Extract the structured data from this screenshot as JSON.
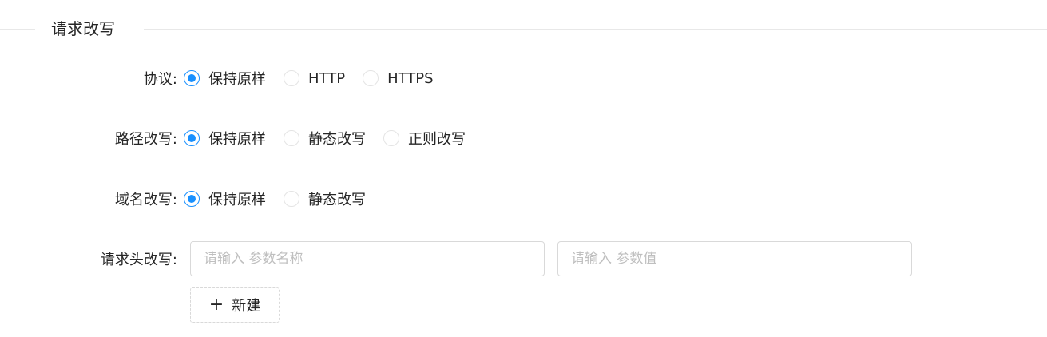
{
  "section": {
    "title": "请求改写"
  },
  "protocol": {
    "label": "协议:",
    "options": [
      {
        "label": "保持原样",
        "checked": true
      },
      {
        "label": "HTTP",
        "checked": false
      },
      {
        "label": "HTTPS",
        "checked": false
      }
    ]
  },
  "path_rewrite": {
    "label": "路径改写:",
    "options": [
      {
        "label": "保持原样",
        "checked": true
      },
      {
        "label": "静态改写",
        "checked": false
      },
      {
        "label": "正则改写",
        "checked": false
      }
    ]
  },
  "domain_rewrite": {
    "label": "域名改写:",
    "options": [
      {
        "label": "保持原样",
        "checked": true
      },
      {
        "label": "静态改写",
        "checked": false
      }
    ]
  },
  "header_rewrite": {
    "label": "请求头改写:",
    "name_placeholder": "请输入 参数名称",
    "name_value": "",
    "value_placeholder": "请输入 参数值",
    "value_value": "",
    "add_button_label": "新建"
  },
  "colors": {
    "accent": "#1890ff",
    "border": "#d9d9d9",
    "divider": "#e8e8e8",
    "placeholder": "#bfbfbf"
  },
  "icons": {
    "add": "plus-icon"
  }
}
